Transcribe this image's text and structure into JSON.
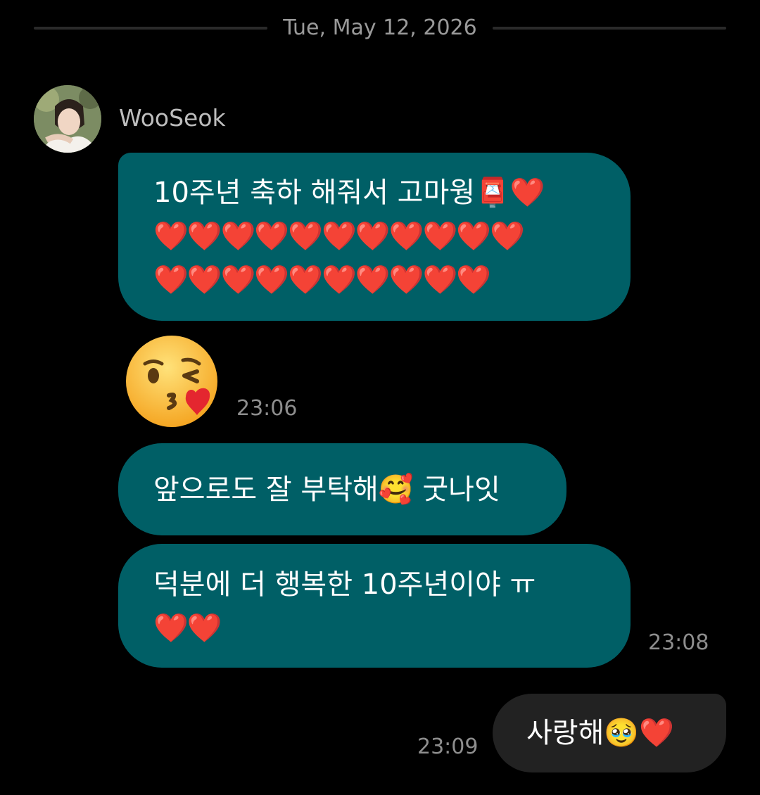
{
  "date_divider": "Tue, May 12, 2026",
  "sender": {
    "name": "WooSeok"
  },
  "messages": [
    {
      "lines": [
        "10주년 축하 해줘서 고마웡📮❤️",
        "❤️❤️❤️❤️❤️❤️❤️❤️❤️❤️❤️",
        "❤️❤️❤️❤️❤️❤️❤️❤️❤️❤️"
      ]
    },
    {
      "sticker": "😘",
      "time": "23:06"
    },
    {
      "lines": [
        "앞으로도 잘 부탁해🥰 굿나잇"
      ]
    },
    {
      "lines": [
        "덕분에 더 행복한 10주년이야 ㅠ",
        "❤️❤️"
      ],
      "time": "23:08"
    }
  ],
  "my_message": {
    "text": "사랑해🥹❤️",
    "time": "23:09"
  },
  "colors": {
    "background": "#000000",
    "incoming_bubble": "#005f66",
    "outgoing_bubble": "#222222",
    "timestamp": "#8e8e8e"
  }
}
